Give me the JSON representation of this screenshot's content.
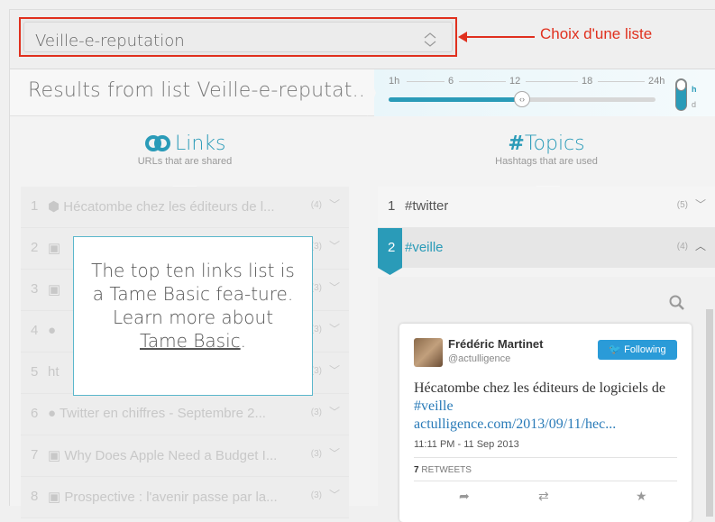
{
  "list_select": {
    "value": "Veille-e-reputation"
  },
  "annotation": "Choix d'une liste",
  "results_title": "Results from list Veille-e-reputat...",
  "timeline": {
    "ticks": [
      "1h",
      "6",
      "12",
      "18",
      "24h"
    ],
    "level_fraction": 0.5,
    "knob_glyph": "‹›",
    "toggle": [
      "h",
      "d"
    ]
  },
  "links_panel": {
    "title": "Links",
    "subtitle": "URLs that are shared",
    "rows": [
      {
        "num": "1",
        "text": "Hécatombe chez les éditeurs de l...",
        "count": "(4)"
      },
      {
        "num": "2",
        "text": "",
        "count": "(3)"
      },
      {
        "num": "3",
        "text": "",
        "count": "(3)"
      },
      {
        "num": "4",
        "text": "",
        "count": "(3)"
      },
      {
        "num": "5",
        "text": "ht",
        "count": "(3)"
      },
      {
        "num": "6",
        "text": "Twitter en chiffres - Septembre 2...",
        "count": "(3)"
      },
      {
        "num": "7",
        "text": "Why Does Apple Need a Budget I...",
        "count": "(3)"
      },
      {
        "num": "8",
        "text": "Prospective : l'avenir passe par la...",
        "count": "(3)"
      }
    ]
  },
  "overlay": {
    "text_before": "The top ten links list is a Tame Basic fea-ture. Learn more about ",
    "link": "Tame Basic",
    "text_after": "."
  },
  "topics_panel": {
    "title": "Topics",
    "subtitle": "Hashtags that are used",
    "rows": [
      {
        "num": "1",
        "text": "#twitter",
        "count": "(5)"
      },
      {
        "num": "2",
        "text": "#veille",
        "count": "(4)"
      }
    ]
  },
  "tweet_card": {
    "name": "Frédéric Martinet",
    "handle": "@actulligence",
    "follow_label": "Following",
    "text": "Hécatombe chez les éditeurs de logiciels de ",
    "hashtag": "#veille",
    "link": "actulligence.com/2013/09/11/hec...",
    "timestamp": "11:11 PM - 11 Sep 2013",
    "retweets_count": "7",
    "retweets_label": "RETWEETS"
  },
  "colors": {
    "accent": "#2a9bb8",
    "annotation": "#e0301e",
    "twitter_blue": "#2a9bd8"
  }
}
